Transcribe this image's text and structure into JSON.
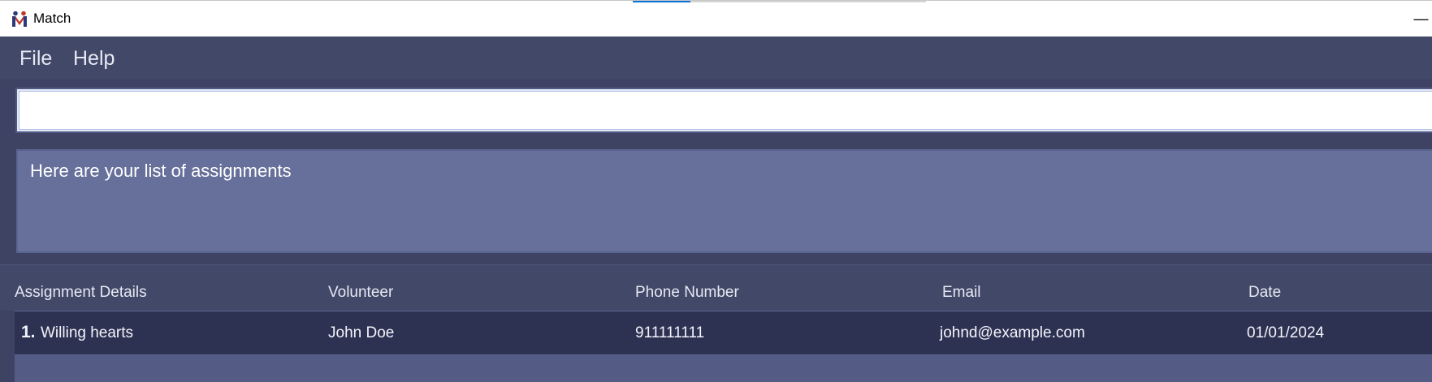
{
  "window": {
    "title": "Match",
    "icon": "app-logo-icon",
    "minimize_glyph": "—"
  },
  "menu": {
    "file": "File",
    "help": "Help"
  },
  "command": {
    "value": "",
    "placeholder": ""
  },
  "result": {
    "message": "Here are your list of assignments"
  },
  "table": {
    "headers": [
      "Assignment Details",
      "Volunteer",
      "Phone Number",
      "Email",
      "Date"
    ],
    "rows": [
      {
        "index": "1.",
        "details": "Willing hearts",
        "volunteer": "John Doe",
        "phone": "911111111",
        "email": "johnd@example.com",
        "date": "01/01/2024"
      }
    ]
  },
  "colors": {
    "menubar": "#424867",
    "result_box": "#66709b",
    "selected_row": "#2e3252",
    "titlebar_accent": "#0a72d6"
  }
}
